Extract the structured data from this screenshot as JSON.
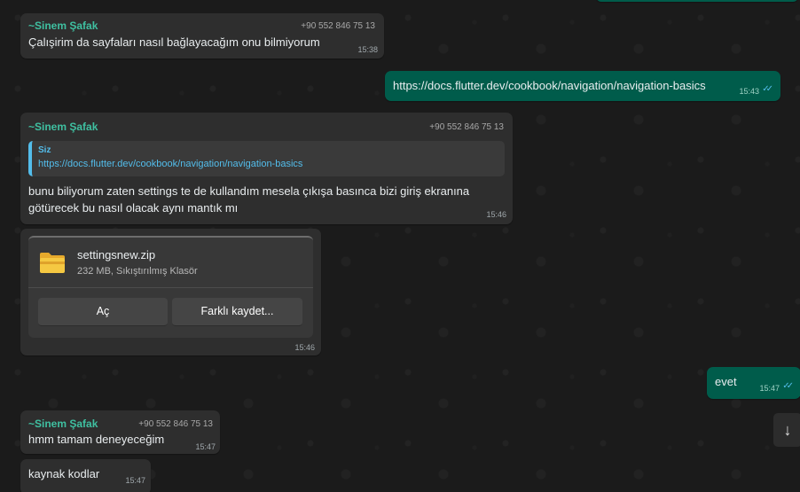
{
  "colors": {
    "background": "#1b1b1b",
    "incoming_bubble": "#2e2e2e",
    "outgoing_bubble": "#005c4b",
    "sender_name": "#3fc0a1",
    "link_quote": "#53bdeb"
  },
  "messages": {
    "m1": {
      "sender": "~Sinem Şafak",
      "phone": "+90 552 846 75 13",
      "text": "Çalışirim da sayfaları nasıl bağlayacağım onu bilmiyorum",
      "time": "15:38"
    },
    "m2": {
      "text": "https://docs.flutter.dev/cookbook/navigation/navigation-basics",
      "time": "15:43",
      "status_icon": "double-check-read-icon"
    },
    "m3": {
      "sender": "~Sinem Şafak",
      "phone": "+90 552 846 75 13",
      "quote_author": "Siz",
      "quote_text": "https://docs.flutter.dev/cookbook/navigation/navigation-basics",
      "text_line1": "bunu biliyorum zaten settings te de kullandım mesela çıkışa basınca bizi giriş ekranına",
      "text_line2": "götürecek bu nasıl olacak aynı mantık mı",
      "time": "15:46"
    },
    "m4": {
      "file_icon": "zip-folder-icon",
      "file_name": "settingsnew.zip",
      "file_meta": "232 MB, Sıkıştırılmış Klasör",
      "open_label": "Aç",
      "save_as_label": "Farklı kaydet...",
      "time": "15:46"
    },
    "m5": {
      "text": "evet",
      "time": "15:47",
      "status_icon": "double-check-read-icon"
    },
    "m6": {
      "sender": "~Sinem Şafak",
      "phone": "+90 552 846 75 13",
      "text": "hmm tamam deneyeceğim",
      "time": "15:47"
    },
    "m7": {
      "text": "kaynak kodlar",
      "time": "15:47"
    }
  },
  "scroll_button": {
    "icon": "arrow-down-icon",
    "glyph": "↓"
  }
}
